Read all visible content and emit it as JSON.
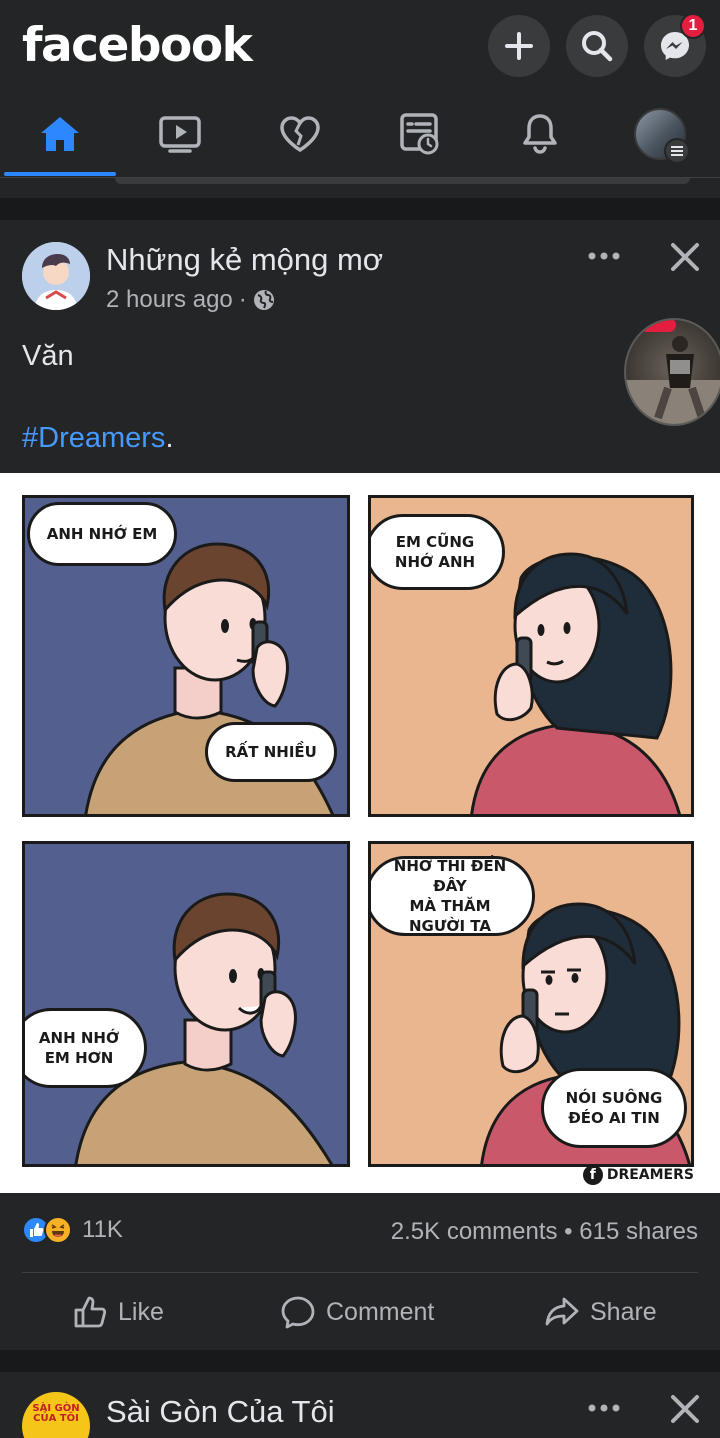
{
  "header": {
    "logo": "facebook",
    "messenger_badge": "1",
    "buttons": [
      {
        "name": "create",
        "icon": "plus-icon"
      },
      {
        "name": "search",
        "icon": "search-icon"
      },
      {
        "name": "messenger",
        "icon": "messenger-icon"
      }
    ]
  },
  "nav": {
    "tabs": [
      {
        "name": "home",
        "icon": "home-icon",
        "active": true
      },
      {
        "name": "watch",
        "icon": "video-icon",
        "active": false
      },
      {
        "name": "dating",
        "icon": "heart-icon",
        "active": false
      },
      {
        "name": "news",
        "icon": "news-icon",
        "active": false
      },
      {
        "name": "notifications",
        "icon": "bell-icon",
        "active": false
      },
      {
        "name": "profile-menu",
        "icon": "avatar",
        "active": false
      }
    ],
    "accent_color": "#2d88ff"
  },
  "post": {
    "author": "Những kẻ mộng mơ",
    "time": "2 hours ago",
    "audience_sep": "·",
    "audience_icon": "globe-icon",
    "text_line": "Văn",
    "hashtag": "#Dreamers",
    "hashtag_suffix": ".",
    "comic": {
      "bubbles": [
        "ANH NHỚ EM",
        "RẤT NHIỀU",
        "EM CŨNG\nNHỚ ANH",
        "ANH NHỚ\nEM HƠN",
        "NHỚ THÌ ĐẾN ĐÂY\nMÀ THĂM NGƯỜI TA",
        "NÓI SUÔNG\nĐÉO AI TIN"
      ],
      "watermark": "DREAMERS"
    },
    "reactions": {
      "icons": [
        "like-icon",
        "haha-icon"
      ],
      "count": "11K"
    },
    "comments_shares": "2.5K comments • 615 shares",
    "actions": {
      "like": "Like",
      "comment": "Comment",
      "share": "Share"
    }
  },
  "next_post": {
    "author": "Sài Gòn Của Tôi",
    "avatar_text": "SÀI GÒN\nCỦA TÔI"
  }
}
